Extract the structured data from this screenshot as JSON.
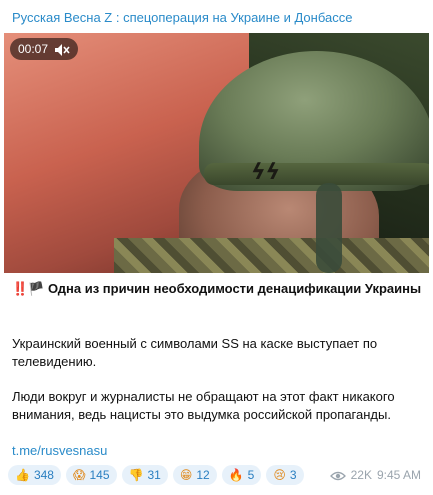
{
  "post": {
    "channel_name": "Русская Весна Z : спецоперация на Украине и Донбассе",
    "video": {
      "duration": "00:07",
      "sound_icon": "mute-icon"
    },
    "headline_emoji": "‼️🏴",
    "headline": "Одна из причин необходимости денацификации Украины",
    "paragraph_1": "Украинский военный с символами SS на каске выступает по телевидению.",
    "paragraph_2": "Люди вокруг и журналисты не обращают на этот факт никакого внимания, ведь нацисты это выдумка российской пропаганды.",
    "link": "t.me/rusvesnasu",
    "reactions": [
      {
        "icon": "👍",
        "count": "348"
      },
      {
        "icon": "😱",
        "count": "145"
      },
      {
        "icon": "👎",
        "count": "31"
      },
      {
        "icon": "😁",
        "count": "12"
      },
      {
        "icon": "🔥",
        "count": "5"
      },
      {
        "icon": "😢",
        "count": "3"
      }
    ],
    "views": "22K",
    "time": "9:45 AM"
  },
  "colors": {
    "accent": "#2a8bc9",
    "reaction_bg": "#e7f1fa",
    "meta": "#9aa4ad"
  }
}
